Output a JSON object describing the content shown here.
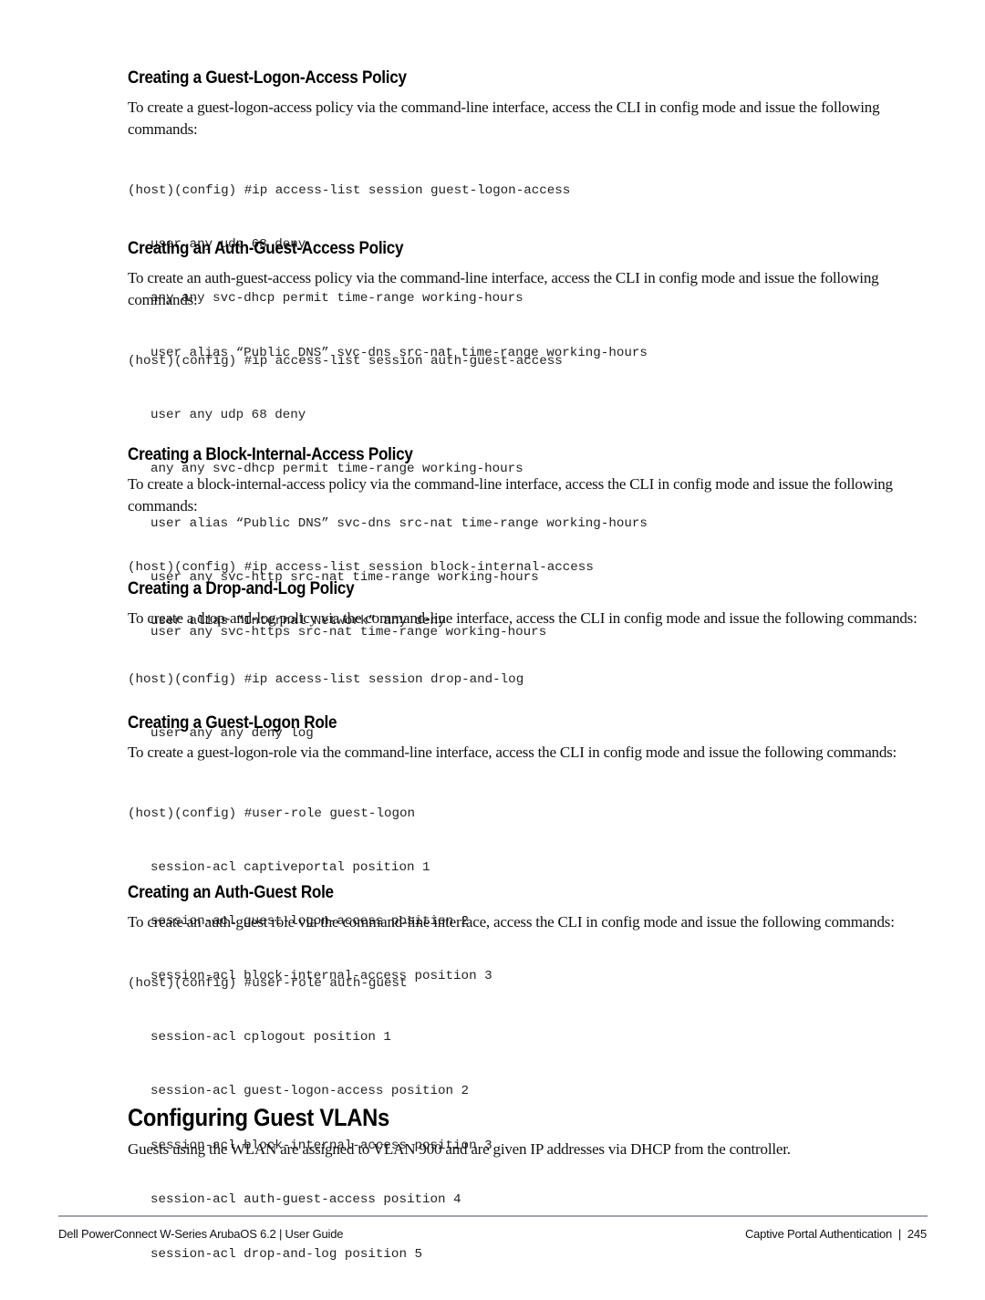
{
  "sections": [
    {
      "heading": "Creating a Guest-Logon-Access Policy",
      "paragraph": "To create a guest-logon-access policy via the command-line interface, access the CLI in config mode and issue the following commands:",
      "command": "(host)(config) #ip access-list session guest-logon-access",
      "lines": [
        "user any udp 68 deny",
        "any any svc-dhcp permit time-range working-hours",
        "user alias “Public DNS” svc-dns src-nat time-range working-hours"
      ]
    },
    {
      "heading": "Creating an Auth-Guest-Access Policy",
      "paragraph": "To create an auth-guest-access policy via the command-line interface, access the CLI in config mode and issue the following commands:",
      "command": "(host)(config) #ip access-list session auth-guest-access",
      "lines": [
        "user any udp 68 deny",
        "any any svc-dhcp permit time-range working-hours",
        "user alias “Public DNS” svc-dns src-nat time-range working-hours",
        "user any svc-http src-nat time-range working-hours",
        "user any svc-https src-nat time-range working-hours"
      ]
    },
    {
      "heading": "Creating a Block-Internal-Access Policy",
      "paragraph": "To create a block-internal-access policy via the command-line interface, access the CLI in config mode and issue the following commands:",
      "command": "(host)(config) #ip access-list session block-internal-access",
      "lines": [
        "user alias “Internal Network” any deny"
      ]
    },
    {
      "heading": "Creating a Drop-and-Log Policy",
      "paragraph": "To create a drop-and-log policy via the command-line interface, access the CLI in config mode and issue the following commands:",
      "command": "(host)(config) #ip access-list session drop-and-log",
      "lines": [
        "user any any deny log"
      ]
    },
    {
      "heading": "Creating a Guest-Logon Role",
      "paragraph": "To create a guest-logon-role via the command-line interface, access the CLI in config mode and issue the following commands:",
      "command": "(host)(config) #user-role guest-logon",
      "lines": [
        "session-acl captiveportal position 1",
        "session-acl guest-logon-access position 2",
        "session-acl block-internal-access position 3"
      ]
    },
    {
      "heading": "Creating an Auth-Guest Role",
      "paragraph": "To create an auth-guest role via the command-line interface, access the CLI in config mode and issue the following commands:",
      "command": "(host)(config) #user-role auth-guest",
      "lines": [
        "session-acl cplogout position 1",
        "session-acl guest-logon-access position 2",
        "session-acl block-internal-access position 3",
        "session-acl auth-guest-access position 4",
        "session-acl drop-and-log position 5"
      ]
    }
  ],
  "main_section": {
    "heading": "Configuring Guest VLANs",
    "paragraph": "Guests using the WLAN are assigned to VLAN 900 and are given IP addresses via DHCP from the controller."
  },
  "footer": {
    "left": "Dell PowerConnect W-Series ArubaOS 6.2 | User Guide",
    "right": "Captive Portal Authentication  |  245"
  }
}
